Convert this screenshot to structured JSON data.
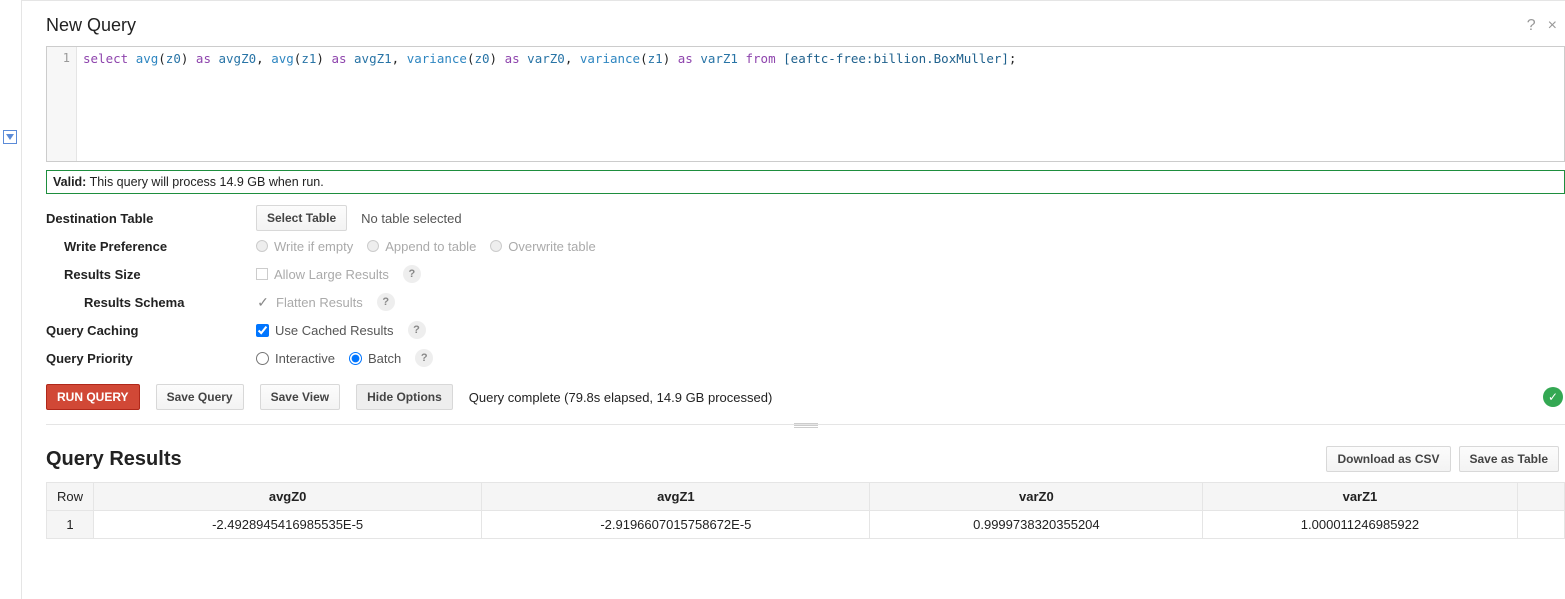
{
  "header": {
    "title": "New Query",
    "help_icon": "?",
    "close_icon": "×"
  },
  "editor": {
    "line_no": "1",
    "tokens": [
      {
        "t": "select ",
        "c": "kw"
      },
      {
        "t": "avg",
        "c": "fn"
      },
      {
        "t": "(",
        "c": "op"
      },
      {
        "t": "z0",
        "c": "id"
      },
      {
        "t": ") ",
        "c": "op"
      },
      {
        "t": "as ",
        "c": "kw"
      },
      {
        "t": "avgZ0",
        "c": "id"
      },
      {
        "t": ", ",
        "c": "op"
      },
      {
        "t": "avg",
        "c": "fn"
      },
      {
        "t": "(",
        "c": "op"
      },
      {
        "t": "z1",
        "c": "id"
      },
      {
        "t": ") ",
        "c": "op"
      },
      {
        "t": "as ",
        "c": "kw"
      },
      {
        "t": "avgZ1",
        "c": "id"
      },
      {
        "t": ", ",
        "c": "op"
      },
      {
        "t": "variance",
        "c": "fn"
      },
      {
        "t": "(",
        "c": "op"
      },
      {
        "t": "z0",
        "c": "id"
      },
      {
        "t": ") ",
        "c": "op"
      },
      {
        "t": "as ",
        "c": "kw"
      },
      {
        "t": "varZ0",
        "c": "id"
      },
      {
        "t": ", ",
        "c": "op"
      },
      {
        "t": "variance",
        "c": "fn"
      },
      {
        "t": "(",
        "c": "op"
      },
      {
        "t": "z1",
        "c": "id"
      },
      {
        "t": ") ",
        "c": "op"
      },
      {
        "t": "as ",
        "c": "kw"
      },
      {
        "t": "varZ1",
        "c": "id"
      },
      {
        "t": " ",
        "c": "op"
      },
      {
        "t": "from ",
        "c": "kw"
      },
      {
        "t": "[eaftc-free:billion.BoxMuller]",
        "c": "tbl"
      },
      {
        "t": ";",
        "c": "op"
      }
    ]
  },
  "validation": {
    "label": "Valid:",
    "message": "This query will process 14.9 GB when run."
  },
  "options": {
    "destination_table": {
      "label": "Destination Table",
      "select_button": "Select Table",
      "status": "No table selected"
    },
    "write_preference": {
      "label": "Write Preference",
      "options": [
        "Write if empty",
        "Append to table",
        "Overwrite table"
      ]
    },
    "results_size": {
      "label": "Results Size",
      "option": "Allow Large Results"
    },
    "results_schema": {
      "label": "Results Schema",
      "option": "Flatten Results"
    },
    "query_caching": {
      "label": "Query Caching",
      "option": "Use Cached Results",
      "checked": true
    },
    "query_priority": {
      "label": "Query Priority",
      "options": [
        "Interactive",
        "Batch"
      ],
      "selected": "Batch"
    }
  },
  "actions": {
    "run": "RUN QUERY",
    "save_query": "Save Query",
    "save_view": "Save View",
    "hide_options": "Hide Options",
    "status": "Query complete (79.8s elapsed, 14.9 GB processed)"
  },
  "results": {
    "title": "Query Results",
    "download_csv": "Download as CSV",
    "save_table": "Save as Table",
    "columns": [
      "Row",
      "avgZ0",
      "avgZ1",
      "varZ0",
      "varZ1"
    ],
    "rows": [
      {
        "row": "1",
        "cells": [
          "-2.4928945416985535E-5",
          "-2.9196607015758672E-5",
          "0.9999738320355204",
          "1.000011246985922"
        ]
      }
    ]
  }
}
